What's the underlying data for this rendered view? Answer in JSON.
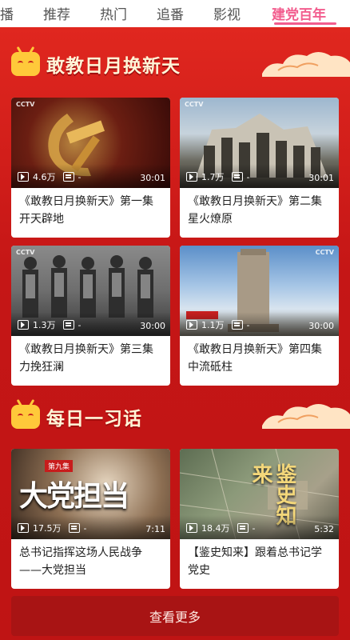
{
  "tabs": [
    {
      "label": "播"
    },
    {
      "label": "推荐"
    },
    {
      "label": "热门"
    },
    {
      "label": "追番"
    },
    {
      "label": "影视"
    },
    {
      "label": "建党百年"
    }
  ],
  "active_tab": "建党百年",
  "sections": [
    {
      "title": "敢教日月换新天",
      "cards": [
        {
          "title": "《敢教日月换新天》第一集 开天辟地",
          "views": "4.6万",
          "danmaku": "-",
          "duration": "30:01",
          "logo": "CCTV"
        },
        {
          "title": "《敢教日月换新天》第二集 星火燎原",
          "views": "1.7万",
          "danmaku": "-",
          "duration": "30:01",
          "logo": "CCTV"
        },
        {
          "title": "《敢教日月换新天》第三集 力挽狂澜",
          "views": "1.3万",
          "danmaku": "-",
          "duration": "30:00",
          "logo": "CCTV"
        },
        {
          "title": "《敢教日月换新天》第四集 中流砥柱",
          "views": "1.1万",
          "danmaku": "-",
          "duration": "30:00",
          "logo": "CCTV"
        }
      ]
    },
    {
      "title": "每日一习话",
      "cards": [
        {
          "title": "总书记指挥这场人民战争——大党担当",
          "views": "17.5万",
          "danmaku": "-",
          "duration": "7:11",
          "overlay_text": "大党担当",
          "badge": "第九集"
        },
        {
          "title": "【鉴史知来】跟着总书记学党史",
          "views": "18.4万",
          "danmaku": "-",
          "duration": "5:32",
          "overlay_text": "鉴史知来"
        }
      ]
    }
  ],
  "more_button": "查看更多",
  "colors": {
    "accent_pink": "#f25d8e",
    "bg_red": "#cf1f1f",
    "title_cream": "#fff5d8"
  }
}
